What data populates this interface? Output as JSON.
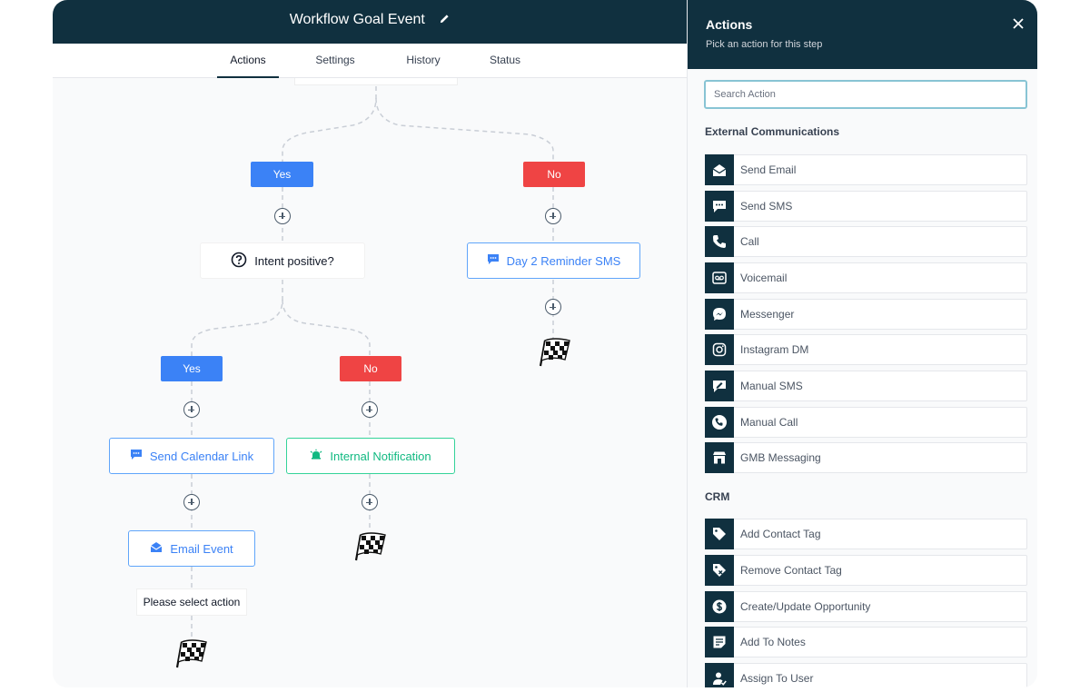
{
  "workflow": {
    "title": "Workflow Goal Event",
    "tabs": [
      {
        "label": "Actions",
        "active": true
      },
      {
        "label": "Settings",
        "active": false
      },
      {
        "label": "History",
        "active": false
      },
      {
        "label": "Status",
        "active": false
      }
    ]
  },
  "canvas": {
    "branch1": {
      "yes": "Yes",
      "no": "No"
    },
    "condition": "Intent positive?",
    "branch2": {
      "yes": "Yes",
      "no": "No"
    },
    "nodes": {
      "day2_sms": "Day 2 Reminder SMS",
      "send_calendar": "Send Calendar Link",
      "internal_notification": "Internal Notification",
      "email_event": "Email Event"
    },
    "placeholder_step": "Please select action"
  },
  "panel": {
    "title": "Actions",
    "subtitle": "Pick an action for this step",
    "search_placeholder": "Search Action",
    "sections": [
      {
        "title": "External Communications",
        "items": [
          {
            "label": "Send Email",
            "icon": "envelope-open-icon"
          },
          {
            "label": "Send SMS",
            "icon": "chat-bubble-icon"
          },
          {
            "label": "Call",
            "icon": "phone-icon"
          },
          {
            "label": "Voicemail",
            "icon": "voicemail-icon"
          },
          {
            "label": "Messenger",
            "icon": "messenger-icon"
          },
          {
            "label": "Instagram DM",
            "icon": "instagram-icon"
          },
          {
            "label": "Manual SMS",
            "icon": "manual-sms-icon"
          },
          {
            "label": "Manual Call",
            "icon": "manual-call-icon"
          },
          {
            "label": "GMB Messaging",
            "icon": "storefront-icon"
          }
        ]
      },
      {
        "title": "CRM",
        "items": [
          {
            "label": "Add Contact Tag",
            "icon": "tag-icon"
          },
          {
            "label": "Remove Contact Tag",
            "icon": "tag-remove-icon"
          },
          {
            "label": "Create/Update Opportunity",
            "icon": "dollar-icon"
          },
          {
            "label": "Add To Notes",
            "icon": "note-icon"
          },
          {
            "label": "Assign To User",
            "icon": "user-assign-icon"
          }
        ]
      }
    ]
  },
  "colors": {
    "header": "#10303f",
    "yes": "#3b82f6",
    "no": "#ef4444",
    "node_blue": "#3b82f6",
    "node_green": "#10b981"
  }
}
